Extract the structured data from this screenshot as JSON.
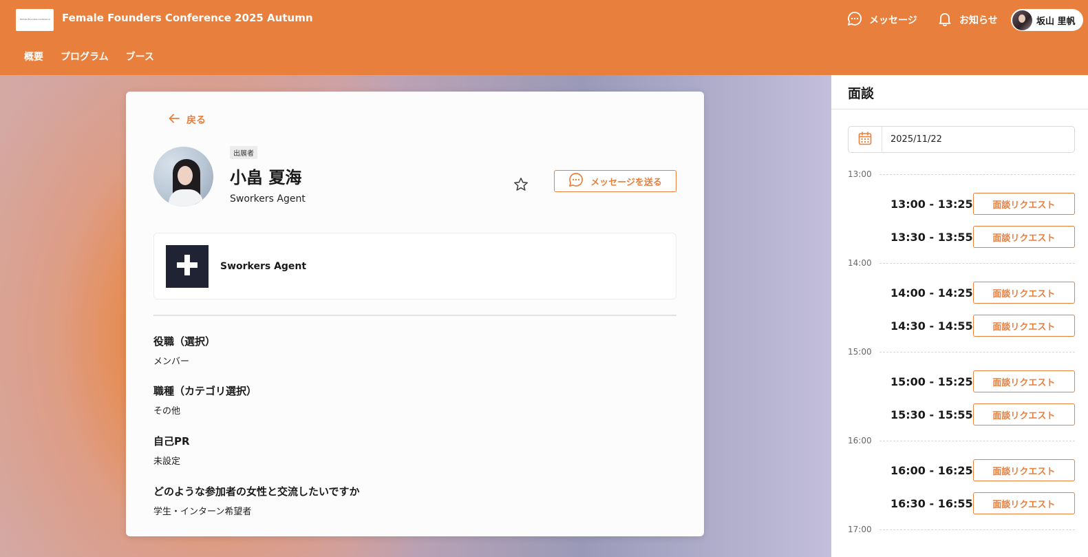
{
  "header": {
    "logo_text": "Female Founders Conference",
    "event_title": "Female Founders Conference 2025 Autumn",
    "message_label": "メッセージ",
    "notification_label": "お知らせ",
    "user_name": "坂山 里帆"
  },
  "nav": {
    "tabs": [
      "概要",
      "プログラム",
      "ブース"
    ]
  },
  "profile": {
    "back_label": "戻る",
    "role_badge": "出展者",
    "name": "小畠 夏海",
    "company": "Sworkers Agent",
    "send_message_label": "メッセージを送る",
    "company_box_name": "Sworkers Agent",
    "fields": [
      {
        "label": "役職（選択）",
        "value": "メンバー"
      },
      {
        "label": "職種（カテゴリ選択）",
        "value": "その他"
      },
      {
        "label": "自己PR",
        "value": "未設定"
      },
      {
        "label": "どのような参加者の女性と交流したいですか",
        "value": "学生・インターン希望者"
      }
    ]
  },
  "sidebar": {
    "title": "面談",
    "date": "2025/11/22",
    "hours": [
      "13:00",
      "14:00",
      "15:00",
      "16:00",
      "17:00"
    ],
    "slots": [
      {
        "time": "13:00 - 13:25",
        "button": "面談リクエスト"
      },
      {
        "time": "13:30 - 13:55",
        "button": "面談リクエスト"
      },
      {
        "time": "14:00 - 14:25",
        "button": "面談リクエスト"
      },
      {
        "time": "14:30 - 14:55",
        "button": "面談リクエスト"
      },
      {
        "time": "15:00 - 15:25",
        "button": "面談リクエスト"
      },
      {
        "time": "15:30 - 15:55",
        "button": "面談リクエスト"
      },
      {
        "time": "16:00 - 16:25",
        "button": "面談リクエスト"
      },
      {
        "time": "16:30 - 16:55",
        "button": "面談リクエスト"
      }
    ]
  },
  "icons": {
    "message": "chat-bubble-icon",
    "notification": "bell-icon",
    "back": "arrow-left-icon",
    "favorite": "star-outline-icon",
    "calendar": "calendar-icon",
    "company_logo": "plus-mark-icon"
  },
  "colors": {
    "accent": "#e87f3c",
    "company_logo_bg": "#1f2333"
  }
}
